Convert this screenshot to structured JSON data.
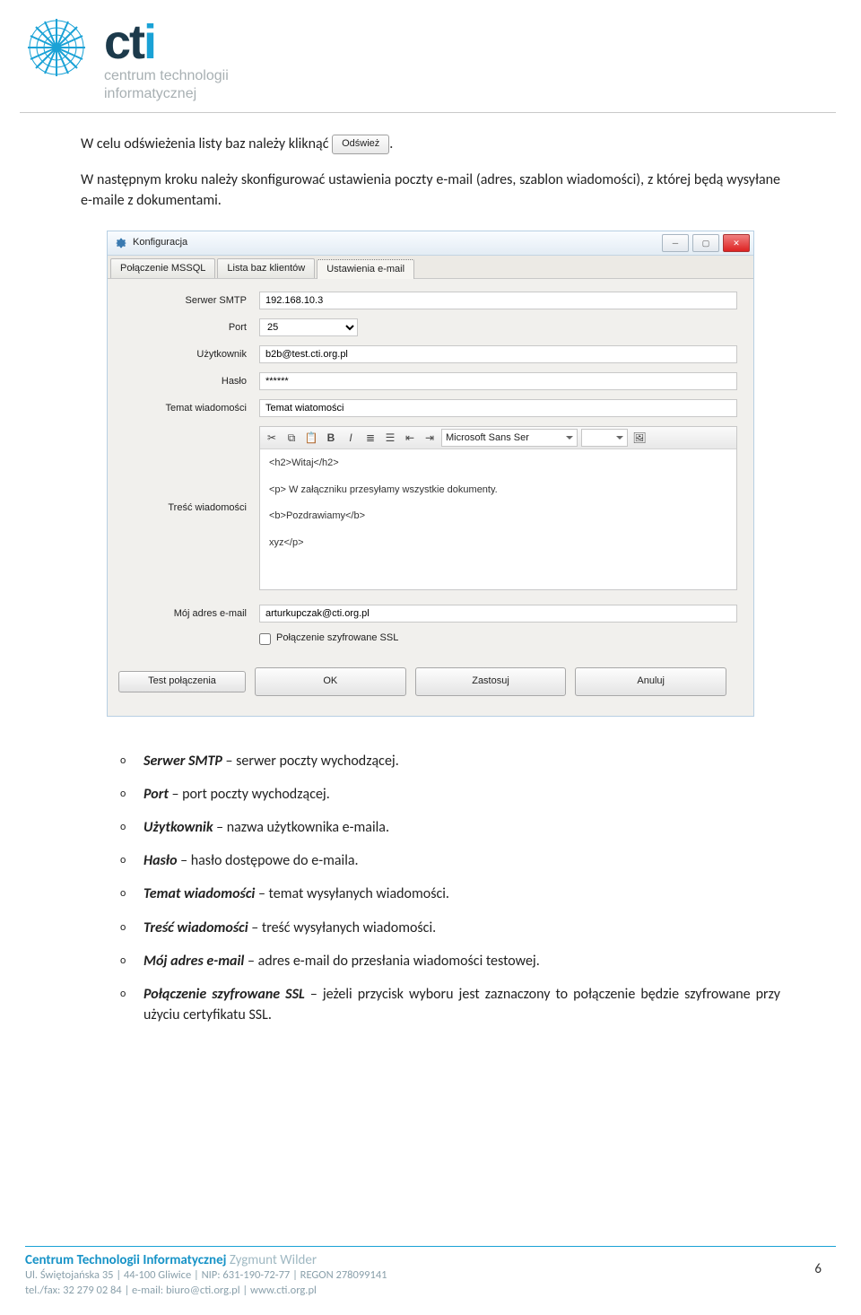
{
  "logo": {
    "sub1": "centrum technologii",
    "sub2": "informatycznej"
  },
  "para1_prefix": "W celu odświeżenia listy baz należy kliknąć ",
  "refresh_btn": "Odśwież",
  "para1_suffix": ".",
  "para2": "W następnym kroku należy skonfigurować ustawienia poczty e-mail (adres, szablon wiadomości), z której będą wysyłane e-maile z dokumentami.",
  "window": {
    "title": "Konfiguracja",
    "tabs": {
      "t1": "Połączenie MSSQL",
      "t2": "Lista baz klientów",
      "t3": "Ustawienia e-mail"
    },
    "labels": {
      "smtp": "Serwer SMTP",
      "port": "Port",
      "user": "Użytkownik",
      "pass": "Hasło",
      "subject": "Temat wiadomości",
      "body": "Treść wiadomości",
      "myemail": "Mój adres e-mail",
      "ssl": "Połączenie szyfrowane SSL"
    },
    "values": {
      "smtp": "192.168.10.3",
      "port": "25",
      "user": "b2b@test.cti.org.pl",
      "pass": "******",
      "subject": "Temat wiatomości",
      "font": "Microsoft Sans Ser",
      "body_l1": "<h2>Witaj</h2>",
      "body_l2": "<p> W załączniku przesyłamy wszystkie dokumenty.",
      "body_l3": "<b>Pozdrawiamy</b>",
      "body_l4": "xyz</p>",
      "myemail": "arturkupczak@cti.org.pl"
    },
    "buttons": {
      "test": "Test połączenia",
      "ok": "OK",
      "apply": "Zastosuj",
      "cancel": "Anuluj"
    }
  },
  "desc": {
    "i1_b": "Serwer SMTP",
    "i1_t": " – serwer poczty wychodzącej.",
    "i2_b": "Port",
    "i2_t": " – port poczty wychodzącej.",
    "i3_b": "Użytkownik",
    "i3_t": " – nazwa użytkownika e-maila.",
    "i4_b": "Hasło",
    "i4_t": " – hasło dostępowe do e-maila.",
    "i5_b": "Temat wiadomości",
    "i5_t": " – temat wysyłanych wiadomości.",
    "i6_b": "Treść wiadomości",
    "i6_t": " – treść wysyłanych wiadomości.",
    "i7_b": "Mój adres e-mail",
    "i7_t": " – adres e-mail do przesłania wiadomości testowej.",
    "i8_b": "Połączenie szyfrowane SSL",
    "i8_t": " – jeżeli przycisk wyboru jest zaznaczony to połączenie będzie szyfrowane przy użyciu certyfikatu SSL."
  },
  "footer": {
    "line1a": "Centrum Technologii Informatycznej",
    "line1b": " Zygmunt Wilder",
    "line2": "Ul. Świętojańska 35 | 44-100 Gliwice | NIP: 631-190-72-77 | REGON 278099141",
    "line3": "tel./fax: 32 279 02 84 | e-mail: biuro@cti.org.pl | www.cti.org.pl",
    "pagenum": "6"
  }
}
